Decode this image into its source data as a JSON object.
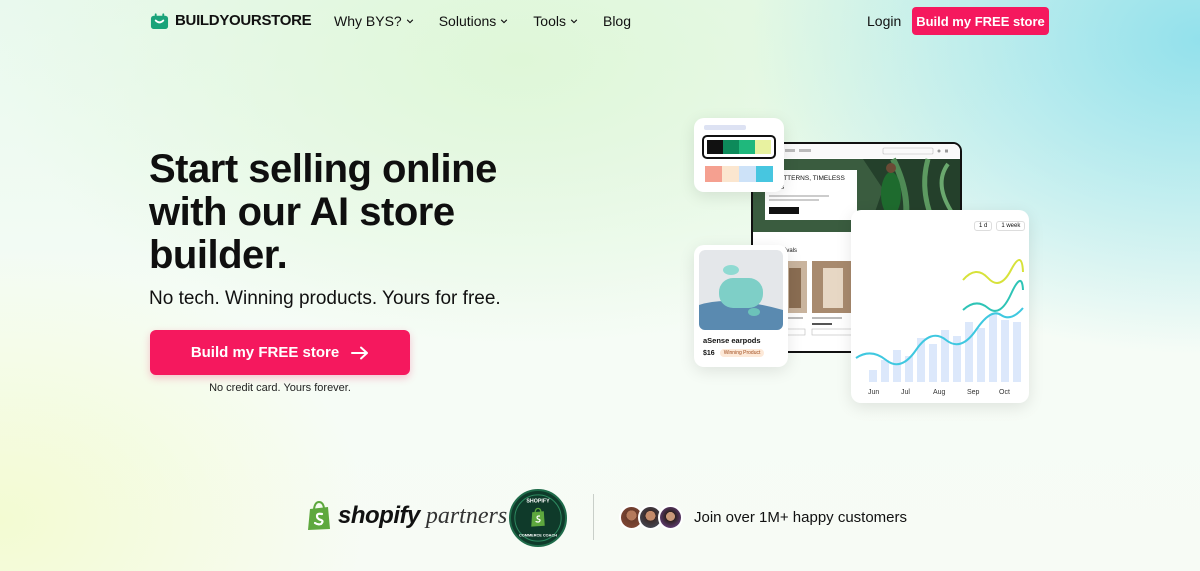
{
  "brand": {
    "name_part1": "BUILD",
    "name_part2": "YOURSTORE",
    "accent": "#1aa37a"
  },
  "nav": {
    "items": [
      {
        "label": "Why BYS?",
        "has_dropdown": true
      },
      {
        "label": "Solutions",
        "has_dropdown": true
      },
      {
        "label": "Tools",
        "has_dropdown": true
      },
      {
        "label": "Blog",
        "has_dropdown": false
      }
    ],
    "login_label": "Login",
    "cta_label": "Build my FREE store"
  },
  "hero": {
    "title": "Start selling online with our AI store builder.",
    "subtitle": "No tech. Winning products. Yours for free.",
    "cta_label": "Build my FREE store",
    "note": "No credit card. Yours forever."
  },
  "illustration": {
    "browser_banner_text": "D PATTERNS, TIMELESS SICS",
    "browser_section_label": "rivals",
    "product": {
      "name": "aSense earpods",
      "price": "$16",
      "badge": "Winning Product"
    },
    "chart_toggle": [
      "1 d",
      "1 week"
    ],
    "chart_months": [
      "Jun",
      "Jul",
      "Aug",
      "Sep",
      "Oct"
    ]
  },
  "trust": {
    "shopify_word": "shopify",
    "partners_word": "partners",
    "badge_top": "SHOPIFY",
    "badge_bottom": "COMMERCE COACH",
    "customers_text": "Join over 1M+ happy customers"
  },
  "colors": {
    "primary": "#f5185e",
    "dark_green": "#0f3a2a",
    "teal": "#1fb5a8"
  }
}
